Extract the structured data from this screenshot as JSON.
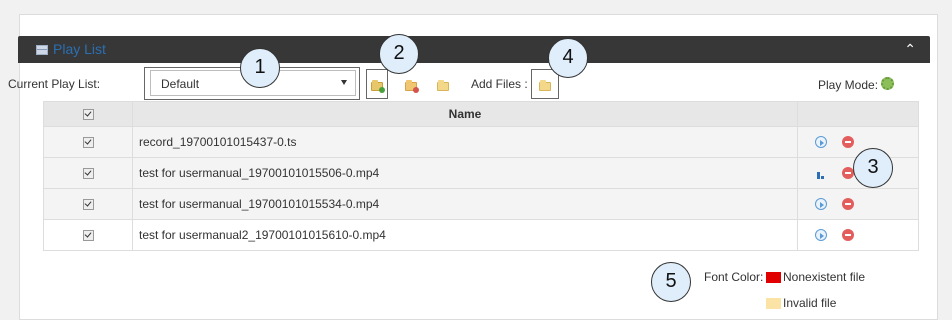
{
  "header": {
    "title": "Play List",
    "collapse_glyph": "⌃"
  },
  "toolbar": {
    "current_label": "Current Play List:",
    "select_value": "Default",
    "add_files_label": "Add Files :",
    "play_mode_label": "Play Mode:"
  },
  "table": {
    "name_header": "Name",
    "rows": [
      {
        "checked": true,
        "name": "record_19700101015437-0.ts",
        "action": "play"
      },
      {
        "checked": true,
        "name": "test for usermanual_19700101015506-0.mp4",
        "action": "playing"
      },
      {
        "checked": true,
        "name": "test for usermanual_19700101015534-0.mp4",
        "action": "play"
      },
      {
        "checked": true,
        "name": "test for usermanual2_19700101015610-0.mp4",
        "action": "play"
      }
    ]
  },
  "legend": {
    "font_color_label": "Font Color:",
    "nonexistent_label": "Nonexistent file",
    "nonexistent_color": "#e00000",
    "invalid_label": "Invalid file",
    "invalid_color": "#fbe3a6"
  },
  "callouts": [
    "1",
    "2",
    "3",
    "4",
    "5"
  ]
}
